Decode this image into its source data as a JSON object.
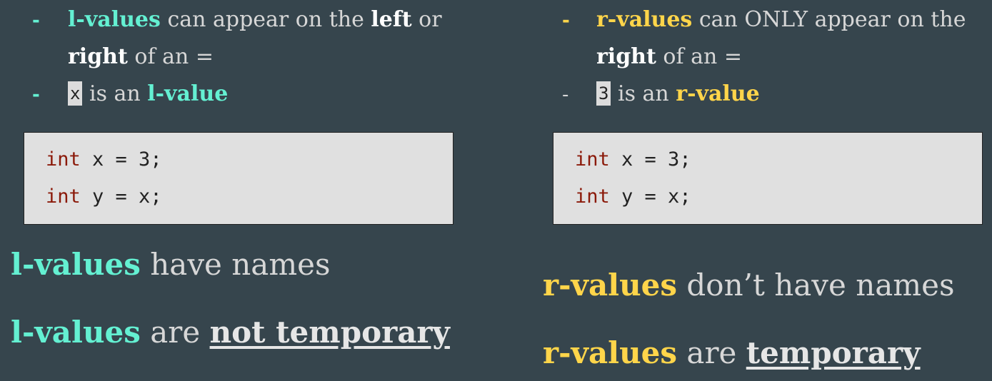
{
  "left": {
    "bullet1": {
      "dash": "-",
      "term": "l-values",
      "mid": " can appear on the ",
      "word1": "left",
      "mid2": " or",
      "word2": "right",
      "tail": " of an ="
    },
    "bullet2": {
      "dash": "-",
      "chip": "x",
      "mid": " is an ",
      "term": "l-value"
    },
    "code": {
      "line1_kw": "int",
      "line1_rest": " x = 3;",
      "line2_kw": "int",
      "line2_rest": " y = x;"
    },
    "stmt1": {
      "term": "l-values",
      "rest": " have names"
    },
    "stmt2": {
      "term": "l-values",
      "mid": " are ",
      "emph": "not temporary"
    }
  },
  "right": {
    "bullet1": {
      "dash": "-",
      "term": "r-values",
      "mid": " can ONLY appear on the",
      "word": "right",
      "tail": " of an ="
    },
    "bullet2": {
      "dash": "-",
      "chip": "3",
      "mid": " is an ",
      "term": "r-value"
    },
    "code": {
      "line1_kw": "int",
      "line1_rest": " x = 3;",
      "line2_kw": "int",
      "line2_rest": " y = x;"
    },
    "stmt1": {
      "term": "r-values",
      "rest": " don’t have names"
    },
    "stmt2": {
      "term": "r-values",
      "mid": " are ",
      "emph": "temporary"
    }
  },
  "colors": {
    "background": "#36454d",
    "lvalue_accent": "#64f0d2",
    "rvalue_accent": "#ffd54a",
    "keyword": "#8b1a0a",
    "code_bg": "#e0e0e0"
  }
}
